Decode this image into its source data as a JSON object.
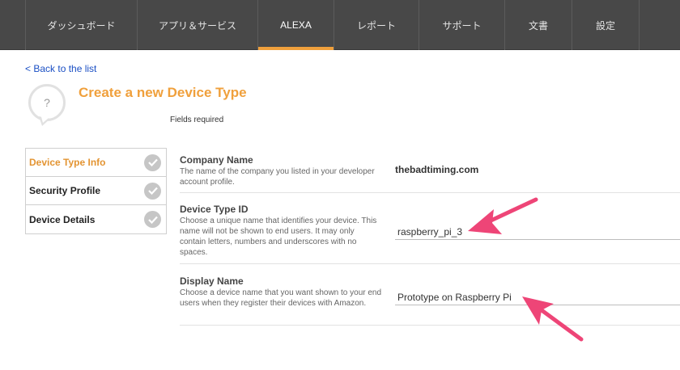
{
  "nav": {
    "items": [
      {
        "label": "ダッシュボード"
      },
      {
        "label": "アプリ＆サービス"
      },
      {
        "label": "ALEXA"
      },
      {
        "label": "レポート"
      },
      {
        "label": "サポート"
      },
      {
        "label": "文書"
      },
      {
        "label": "設定"
      }
    ],
    "active": "ALEXA"
  },
  "back_link": "< Back to the list",
  "page": {
    "title": "Create a new Device Type",
    "fields_required": "Fields required",
    "icon_glyph": "?"
  },
  "steps": [
    {
      "label": "Device Type Info",
      "active": true
    },
    {
      "label": "Security Profile",
      "active": false
    },
    {
      "label": "Device Details",
      "active": false
    }
  ],
  "form": {
    "company": {
      "label": "Company Name",
      "description": "The name of the company you listed in your developer account profile.",
      "value": "thebadtiming.com"
    },
    "device_type_id": {
      "label": "Device Type ID",
      "description": "Choose a unique name that identifies your device. This name will not be shown to end users. It may only contain letters, numbers and underscores with no spaces.",
      "value": "raspberry_pi_3"
    },
    "display_name": {
      "label": "Display Name",
      "description": "Choose a device name that you want shown to your end users when they register their devices with Amazon.",
      "value": "Prototype on Raspberry Pi"
    }
  },
  "colors": {
    "accent": "#f0a03c",
    "nav_bg": "#484848",
    "link": "#1a4fc4",
    "annotation_arrow": "#ee4577"
  }
}
